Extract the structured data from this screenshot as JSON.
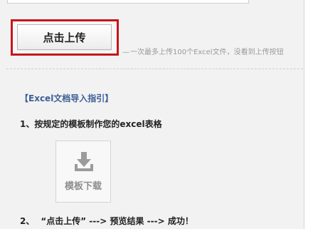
{
  "upload": {
    "button_label": "点击上传",
    "note": "一次最多上传100个Excel文件，没看到上传按钮"
  },
  "guide": {
    "heading": "【Excel文档导入指引】",
    "step1": "1、按规定的模板制作您的excel表格",
    "template_download_label": "模板下载",
    "step2_number": "2、",
    "step2_text": "“点击上传” ---> 预览结果 ---> 成功！"
  },
  "icons": {
    "download": "download-icon"
  },
  "colors": {
    "highlight_border": "#c5161d",
    "guide_heading": "#3d5f95",
    "muted_text": "#9a9a9a",
    "background": "#f2f2f2"
  }
}
